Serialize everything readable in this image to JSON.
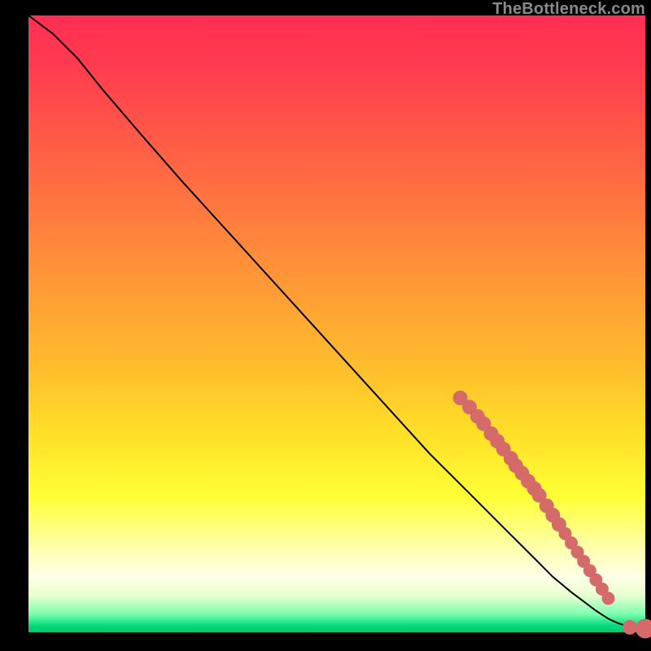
{
  "attribution": "TheBottleneck.com",
  "chart_data": {
    "type": "line",
    "title": "",
    "xlabel": "",
    "ylabel": "",
    "xlim": [
      0,
      100
    ],
    "ylim": [
      0,
      100
    ],
    "grid": false,
    "legend": false,
    "series": [
      {
        "name": "curve",
        "kind": "line",
        "x": [
          0,
          4,
          8,
          12,
          18,
          25,
          35,
          45,
          55,
          65,
          72,
          78,
          82,
          85,
          88,
          90,
          92,
          94,
          95.5,
          97,
          98.5,
          100
        ],
        "y": [
          100,
          97,
          93,
          88,
          81,
          73,
          62,
          51,
          40,
          29,
          22,
          16,
          12,
          9,
          6.5,
          5,
          3.5,
          2.2,
          1.5,
          1.0,
          0.6,
          0.5
        ]
      },
      {
        "name": "points",
        "kind": "scatter",
        "x": [
          70,
          71.5,
          72.8,
          73.8,
          75,
          76,
          77,
          78.2,
          79,
          80,
          81,
          82,
          82.8,
          84,
          85,
          86,
          87,
          88,
          89,
          90,
          91,
          92,
          93,
          94,
          97.5,
          100
        ],
        "y": [
          38,
          36.5,
          35,
          33.8,
          32.2,
          31,
          29.7,
          28.2,
          27,
          25.8,
          24.5,
          23.3,
          22.2,
          20.5,
          19,
          17.5,
          16,
          14.5,
          13,
          11.5,
          10,
          8.5,
          7,
          5.5,
          0.8,
          0.6
        ],
        "r": [
          9,
          9,
          9,
          9,
          9,
          9,
          9,
          9,
          9,
          9,
          9,
          9,
          9,
          9,
          9,
          9,
          8,
          8,
          8,
          8,
          8,
          8,
          8,
          8,
          9,
          12
        ]
      }
    ],
    "background_gradient": {
      "direction": "vertical",
      "stops": [
        {
          "pos": 0.0,
          "color": "#ff2e53"
        },
        {
          "pos": 0.44,
          "color": "#ff9a36"
        },
        {
          "pos": 0.78,
          "color": "#ffff36"
        },
        {
          "pos": 0.91,
          "color": "#ffffe8"
        },
        {
          "pos": 1.0,
          "color": "#00c86e"
        }
      ]
    }
  }
}
